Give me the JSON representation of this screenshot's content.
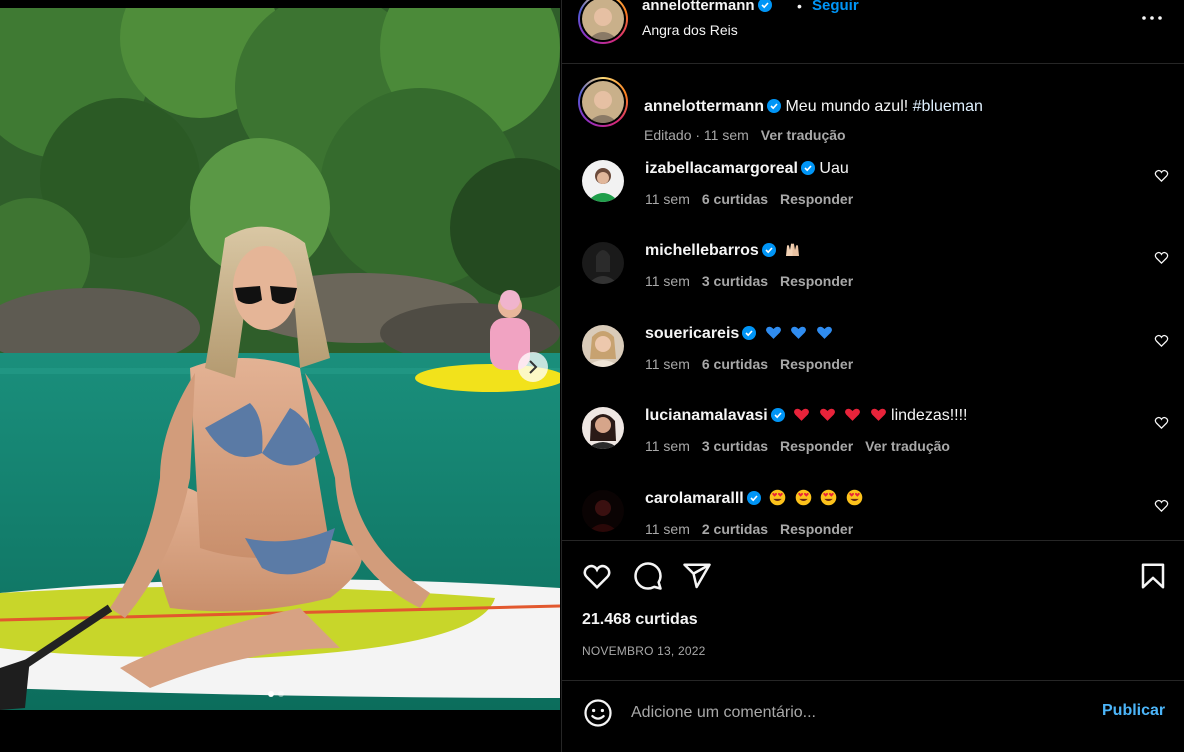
{
  "post": {
    "author": "annelottermann",
    "follow_label": "Seguir",
    "separator": "•",
    "location": "Angra dos Reis",
    "caption_user": "annelottermann",
    "caption_text": "Meu mundo azul!",
    "caption_hashtag": "#blueman",
    "caption_meta": "Editado · 11 sem",
    "caption_translate": "Ver tradução",
    "likes": "21.468 curtidas",
    "date": "NOVEMBRO 13, 2022"
  },
  "comments": [
    {
      "user": "izabellacamargoreal",
      "text": "Uau",
      "emojis": [],
      "time": "11 sem",
      "likes": "6 curtidas",
      "reply": "Responder",
      "translate": ""
    },
    {
      "user": "michellebarros",
      "text": "",
      "emojis": [
        "raised-hands"
      ],
      "time": "11 sem",
      "likes": "3 curtidas",
      "reply": "Responder",
      "translate": ""
    },
    {
      "user": "souericareis",
      "text": "",
      "emojis": [
        "blue-heart",
        "blue-heart",
        "blue-heart"
      ],
      "time": "11 sem",
      "likes": "6 curtidas",
      "reply": "Responder",
      "translate": ""
    },
    {
      "user": "lucianamalavasi",
      "text": "lindezas!!!!",
      "emojis": [
        "red-heart",
        "red-heart",
        "red-heart",
        "red-heart"
      ],
      "time": "11 sem",
      "likes": "3 curtidas",
      "reply": "Responder",
      "translate": "Ver tradução"
    },
    {
      "user": "carolamaralll",
      "text": "",
      "emojis": [
        "heart-eyes",
        "heart-eyes",
        "heart-eyes",
        "heart-eyes"
      ],
      "time": "11 sem",
      "likes": "2 curtidas",
      "reply": "Responder",
      "translate": ""
    }
  ],
  "add_comment": {
    "placeholder": "Adicione um comentário...",
    "publish_label": "Publicar"
  },
  "carousel": {
    "current": 1,
    "total": 2
  },
  "colors": {
    "accent": "#0095f6",
    "publish": "#4cb5f9",
    "muted": "#a8a8a8",
    "background": "#000000",
    "divider": "#262626"
  }
}
